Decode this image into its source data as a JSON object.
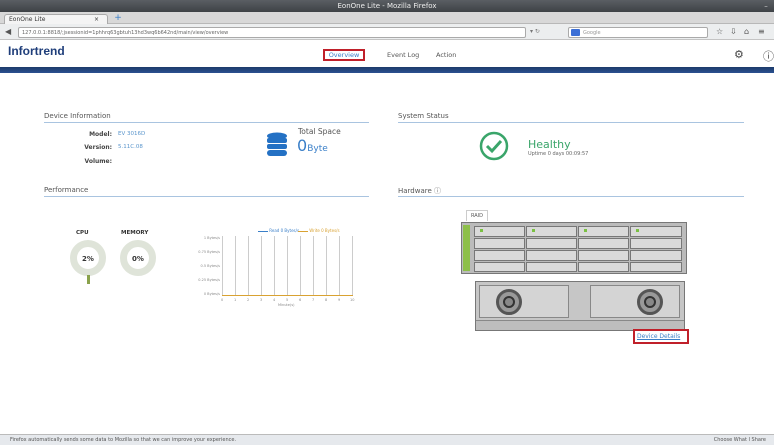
{
  "browser": {
    "window_title": "EonOne Lite - Mozilla Firefox",
    "tab_title": "EonOne Lite",
    "url": "127.0.0.1:8818/;jsessionid=1phhrq63gbtuh13hd3wq6b642nd/main/view/overview",
    "search_engine": "Google",
    "search_placeholder": "Google",
    "status_message": "Firefox automatically sends some data to Mozilla so that we can improve your experience.",
    "status_action": "Choose What I Share"
  },
  "app": {
    "logo": "Infortrend",
    "menu": [
      "Overview",
      "Event Log",
      "Action"
    ],
    "accent": "#2b5191",
    "highlight": "#c0202a"
  },
  "device_info": {
    "title": "Device Information",
    "model_label": "Model:",
    "model": "EV 3016D",
    "version_label": "Version:",
    "version": "5.11C.08",
    "volume_label": "Volume:",
    "volume": "",
    "total_space_label": "Total Space",
    "total_space_value": "0",
    "total_space_unit": "Byte"
  },
  "system_status": {
    "title": "System Status",
    "state": "Healthy",
    "uptime": "Uptime 0 days 00:09:57",
    "status_color": "#3aa56a"
  },
  "performance": {
    "title": "Performance",
    "cpu_label": "CPU",
    "cpu_value": "2%",
    "cpu_fraction": 0.02,
    "memory_label": "MEMORY",
    "memory_value": "0%",
    "memory_fraction": 0.0,
    "legend_read": "Read 0 Bytes/s",
    "legend_write": "Write 0 Bytes/s",
    "y_ticks": [
      "1 Bytes/s",
      "0.75 Bytes/s",
      "0.5 Bytes/s",
      "0.25 Bytes/s",
      "0 Bytes/s"
    ],
    "x_ticks": [
      "0",
      "1",
      "2",
      "3",
      "4",
      "5",
      "6",
      "7",
      "8",
      "9",
      "10"
    ],
    "x_label": "Minute(s)"
  },
  "hardware": {
    "title": "Hardware",
    "raid_label": "RAID",
    "device_details_link": "Device Details"
  }
}
